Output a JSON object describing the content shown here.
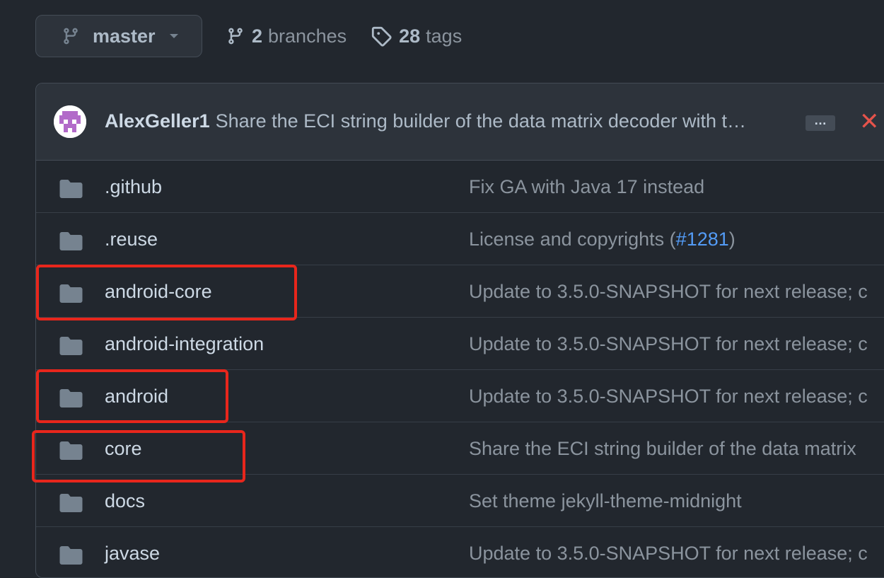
{
  "branch": {
    "name": "master",
    "icon": "git-branch-icon"
  },
  "branches": {
    "count": "2",
    "label": "branches"
  },
  "tags": {
    "count": "28",
    "label": "tags"
  },
  "commit": {
    "author": "AlexGeller1",
    "message": "Share the ECI string builder of the data matrix decoder with t…",
    "more_label": "…",
    "status_symbol": "✕",
    "status_color": "#e5534b"
  },
  "files": [
    {
      "name": ".github",
      "message": "Fix GA with Java 17 instead"
    },
    {
      "name": ".reuse",
      "message_prefix": "License and copyrights (",
      "message_link": "#1281",
      "message_suffix": ")"
    },
    {
      "name": "android-core",
      "message": "Update to 3.5.0-SNAPSHOT for next release; c"
    },
    {
      "name": "android-integration",
      "message": "Update to 3.5.0-SNAPSHOT for next release; c"
    },
    {
      "name": "android",
      "message": "Update to 3.5.0-SNAPSHOT for next release; c"
    },
    {
      "name": "core",
      "message": "Share the ECI string builder of the data matrix"
    },
    {
      "name": "docs",
      "message": "Set theme jekyll-theme-midnight"
    },
    {
      "name": "javase",
      "message": "Update to 3.5.0-SNAPSHOT for next release; c"
    }
  ],
  "colors": {
    "background": "#22272e",
    "highlight": "#e8261c",
    "link": "#539bf5"
  }
}
